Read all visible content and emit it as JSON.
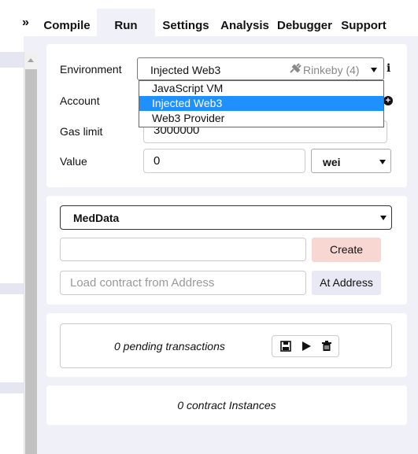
{
  "tabs": {
    "expand_icon": "»",
    "items": [
      {
        "label": "Compile"
      },
      {
        "label": "Run"
      },
      {
        "label": "Settings"
      },
      {
        "label": "Analysis"
      },
      {
        "label": "Debugger"
      },
      {
        "label": "Support"
      }
    ],
    "active": "Run"
  },
  "environment": {
    "label": "Environment",
    "selected": "Injected Web3",
    "network": "Rinkeby (4)",
    "info_icon": "i",
    "options": [
      "JavaScript VM",
      "Injected Web3",
      "Web3 Provider"
    ],
    "highlighted_option": "Injected Web3"
  },
  "account": {
    "label": "Account"
  },
  "gas": {
    "label": "Gas limit",
    "value": "3000000"
  },
  "value": {
    "label": "Value",
    "amount": "0",
    "unit": "wei"
  },
  "contract": {
    "selected": "MedData",
    "create_label": "Create",
    "address_placeholder": "Load contract from Address",
    "at_address_label": "At Address"
  },
  "pending": {
    "text": "0 pending transactions"
  },
  "instances": {
    "text": "0 contract Instances"
  },
  "colors": {
    "panel_bg": "#f0f0f8",
    "create_button": "#f8d7d3",
    "at_address_button": "#e8e9f4",
    "dropdown_highlight": "#1e90ff"
  }
}
